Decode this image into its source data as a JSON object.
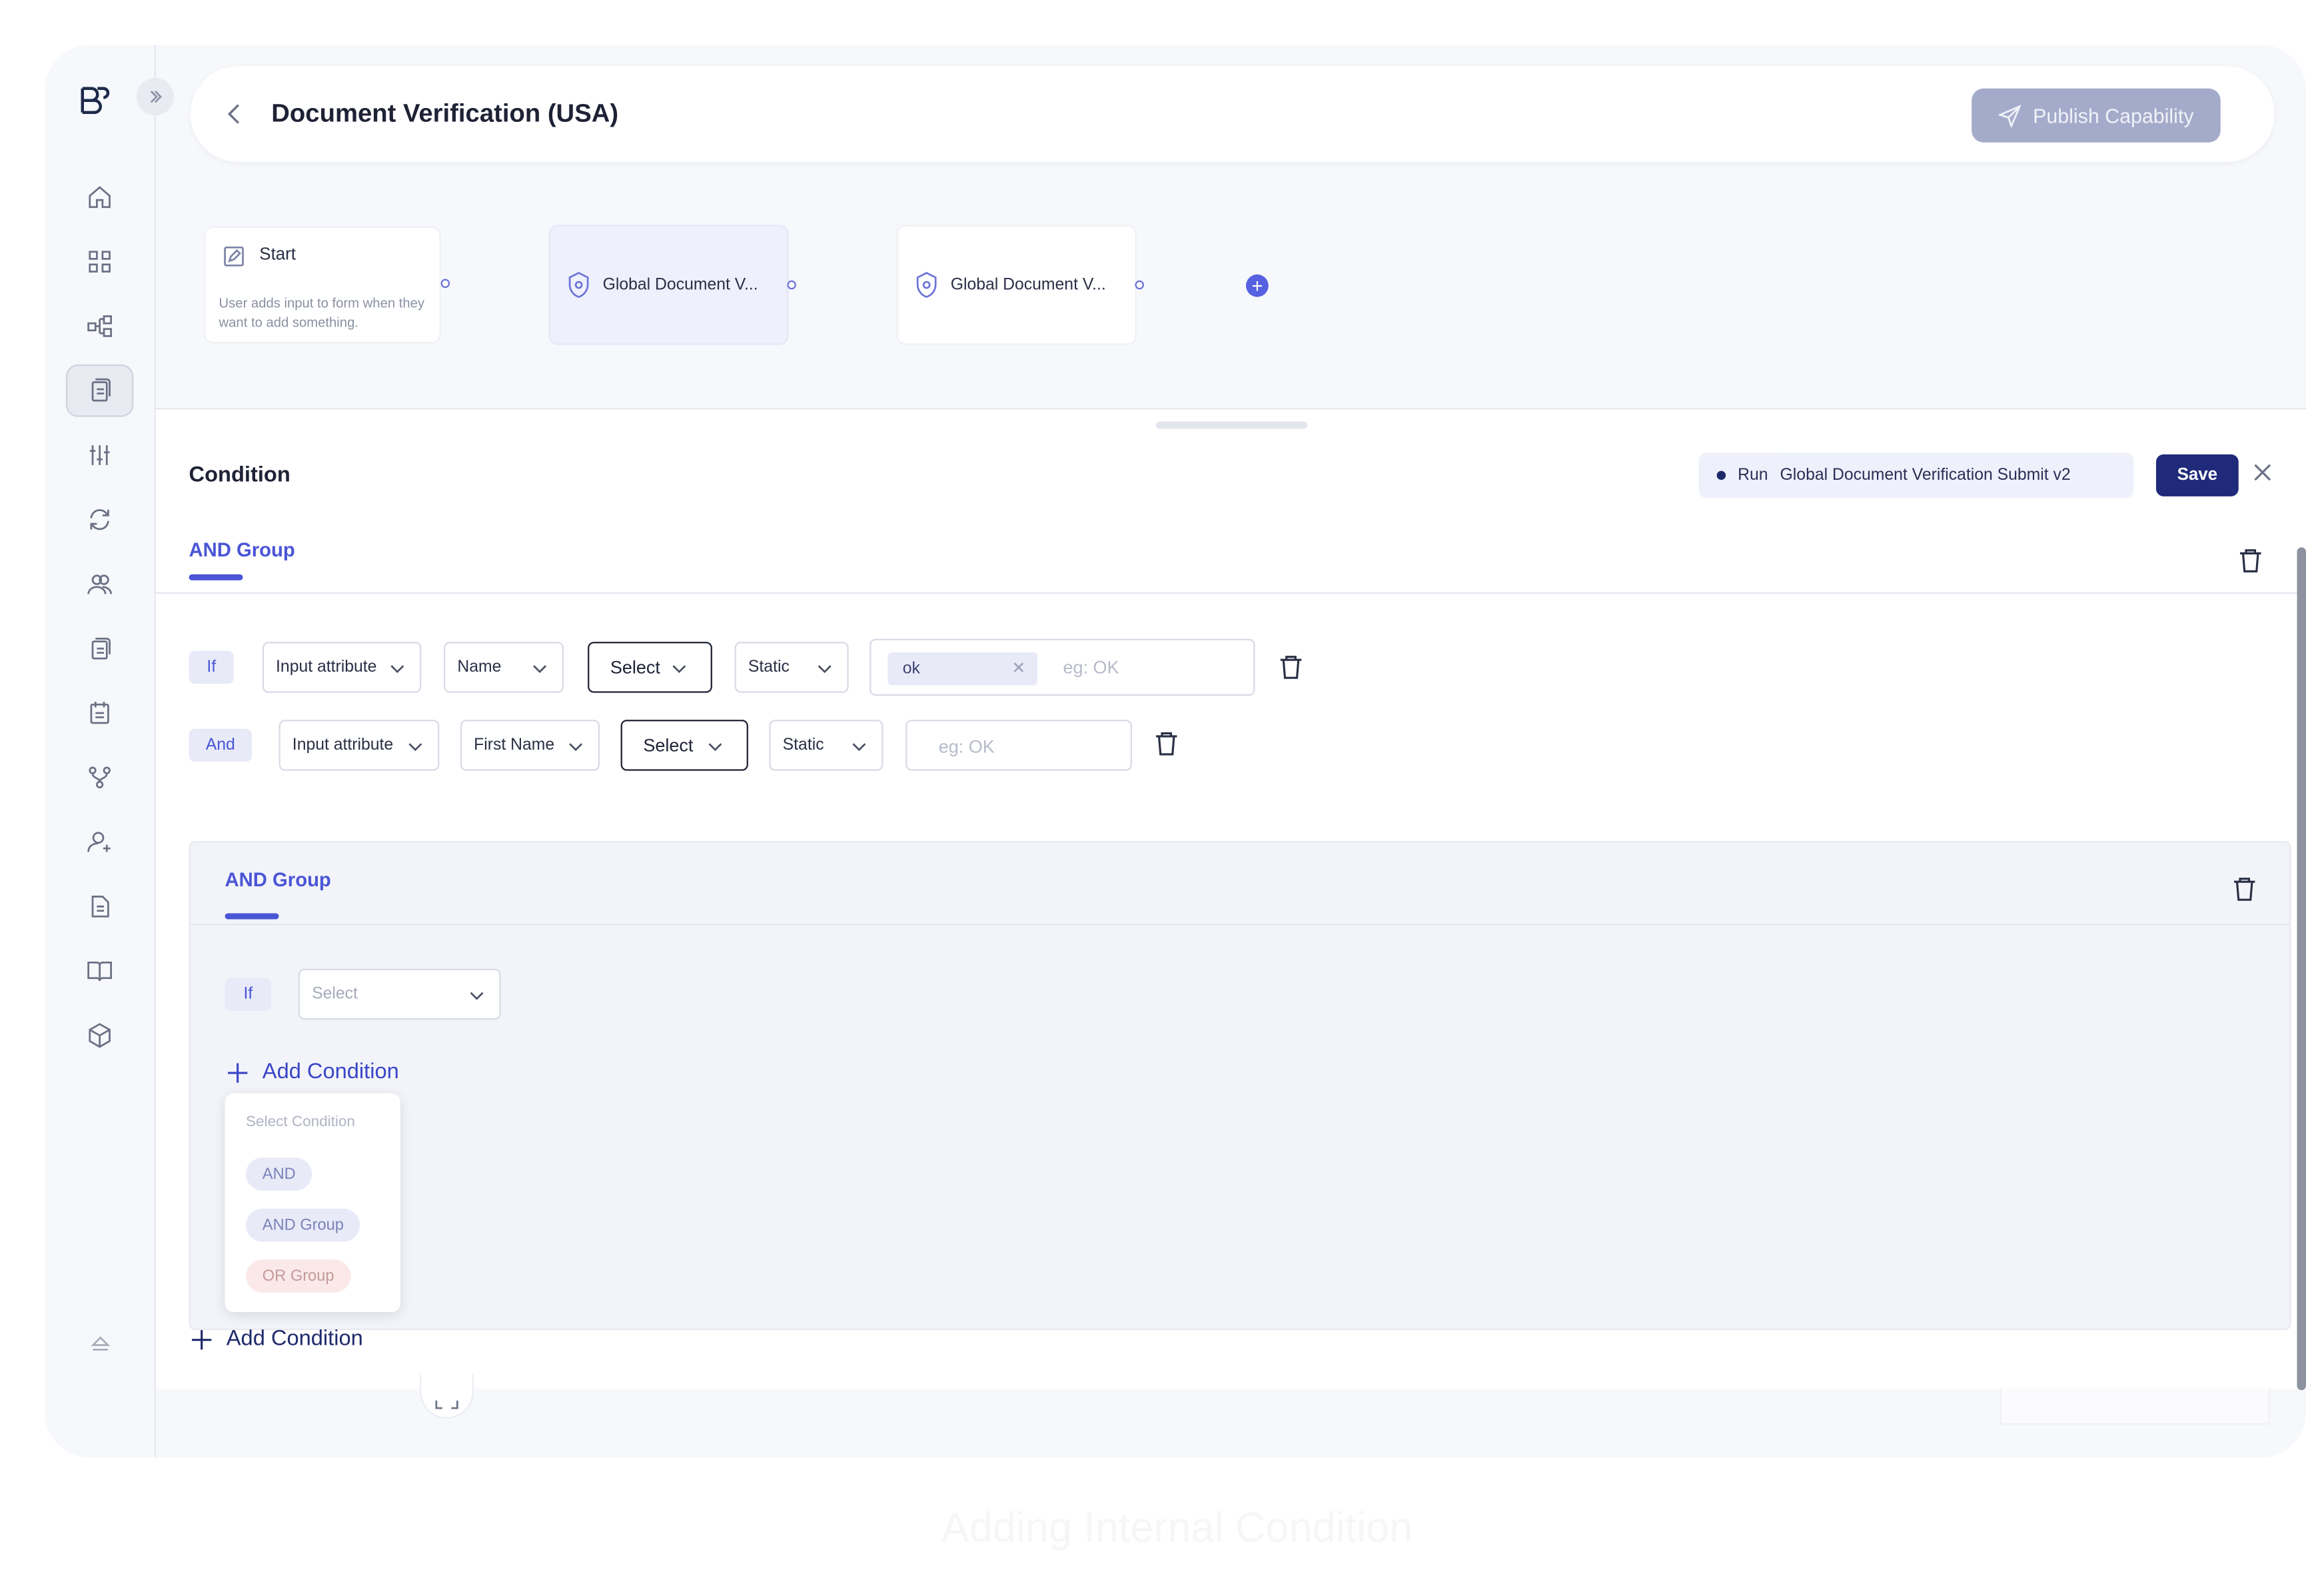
{
  "header": {
    "title": "Document Verification (USA)",
    "publish_label": "Publish Capability"
  },
  "flow": {
    "start": {
      "title": "Start",
      "description": "User adds input to form when they want to add something."
    },
    "nodes": [
      {
        "label": "Global Document V..."
      },
      {
        "label": "Global Document V..."
      }
    ]
  },
  "panel": {
    "title": "Condition",
    "run_label": "Run",
    "run_target": "Global Document Verification Submit v2",
    "save_label": "Save"
  },
  "group": {
    "tab_label": "AND Group",
    "rows": [
      {
        "connector": "If",
        "source": "Input attribute",
        "attribute": "Name",
        "operator": "Select",
        "value_type": "Static",
        "chip": "ok",
        "placeholder": "eg: OK"
      },
      {
        "connector": "And",
        "source": "Input attribute",
        "attribute": "First Name",
        "operator": "Select",
        "value_type": "Static",
        "placeholder": "eg: OK"
      }
    ],
    "nested": {
      "tab_label": "AND Group",
      "row": {
        "connector": "If",
        "select_placeholder": "Select"
      },
      "add_condition_label": "Add Condition",
      "menu": {
        "heading": "Select Condition",
        "options": [
          "AND",
          "AND Group",
          "OR Group"
        ]
      }
    },
    "add_condition_label": "Add Condition"
  },
  "caption": "Adding Internal Condition",
  "colors": {
    "accent": "#4a55d6",
    "primary": "#1f2a7a",
    "publish_disabled": "#a4abca"
  }
}
